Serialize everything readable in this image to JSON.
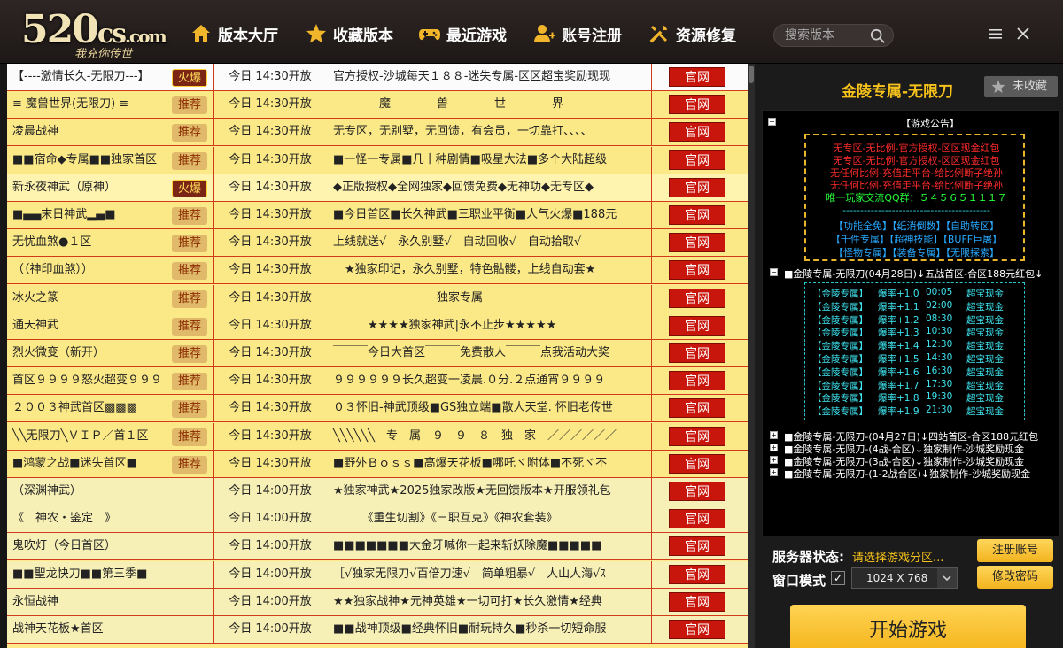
{
  "header": {
    "logo_main": "520",
    "logo_cs": "cs",
    "logo_com": ".com",
    "logo_slogan": "我充你传世",
    "nav": [
      {
        "label": "版本大厅",
        "icon": "home-icon"
      },
      {
        "label": "收藏版本",
        "icon": "star-icon"
      },
      {
        "label": "最近游戏",
        "icon": "gamepad-icon"
      },
      {
        "label": "账号注册",
        "icon": "add-user-icon"
      },
      {
        "label": "资源修复",
        "icon": "tools-icon"
      }
    ],
    "search_placeholder": "搜索版本"
  },
  "list": {
    "button_label": "官网",
    "rows": [
      {
        "name": "【----激情长久-无限刀---】",
        "badge": "火爆",
        "time": "今日 14:30开放",
        "desc": "官方授权-沙城每天１８８-迷失专属-区区超宝奖励现现",
        "style": "sel"
      },
      {
        "name": "≡  魔兽世界(无限刀)  ≡",
        "badge": "推荐",
        "time": "今日 14:30开放",
        "desc": "————魔————兽————世————界————",
        "style": "norm"
      },
      {
        "name": "凌晨战神",
        "badge": "推荐",
        "time": "今日 14:30开放",
        "desc": "无专区，无别墅，无回馈，有会员，一切靠打、、、、",
        "style": "norm"
      },
      {
        "name": "■■宿命◆专属■■独家首区",
        "badge": "推荐",
        "time": "今日 14:30开放",
        "desc": "■一怪一专属■几十种剧情■吸星大法■多个大陆超级",
        "style": "norm"
      },
      {
        "name": "新永夜神武（原神）",
        "badge": "火爆",
        "time": "今日 14:30开放",
        "desc": "◆正版授权◆全网独家◆回馈免费◆无神功◆无专区◆",
        "style": "hot"
      },
      {
        "name": "■▄▄末日神武▂▄■",
        "badge": "推荐",
        "time": "今日 14:30开放",
        "desc": "■今日首区■长久神武■三职业平衡■人气火爆■188元",
        "style": "norm"
      },
      {
        "name": "无忧血煞●１区",
        "badge": "推荐",
        "time": "今日 14:30开放",
        "desc": "上线就送√　永久别墅√　自动回收√　自动拾取√",
        "style": "norm"
      },
      {
        "name": "（（神印血煞））",
        "badge": "推荐",
        "time": "今日 14:30开放",
        "desc": "　★独家印记，永久别墅，特色骷髅，上线自动套★",
        "style": "norm"
      },
      {
        "name": "冰火之篆",
        "badge": "推荐",
        "time": "今日 14:30开放",
        "desc": "　　　　　　　　　独家专属",
        "style": "norm"
      },
      {
        "name": "通天神武",
        "badge": "推荐",
        "time": "今日 14:30开放",
        "desc": "　　　★★★★独家神武|永不止步★★★★★",
        "style": "norm"
      },
      {
        "name": "烈火微变（新开）",
        "badge": "推荐",
        "time": "今日 14:30开放",
        "desc": "￣￣￣今日大首区￣￣￣免费散人￣￣￣点我活动大奖",
        "style": "norm"
      },
      {
        "name": "首区９９９９怒火超变９９９",
        "badge": "推荐",
        "time": "今日 14:30开放",
        "desc": "９９９９９９长久超变一凌晨.０分.２点通宵９９９９",
        "style": "norm"
      },
      {
        "name": "２００３神武首区▩▩▩",
        "badge": "推荐",
        "time": "今日 14:30开放",
        "desc": "０３怀旧-神武顶级■GS独立端■散人天堂. 怀旧老传世",
        "style": "norm"
      },
      {
        "name": "╲╲无限刀╲ＶＩＰ／首１区",
        "badge": "推荐",
        "time": "今日 14:30开放",
        "desc": "╲╲╲╲╲╲　专　属　９　９　８　独　家　／／／／／／",
        "style": "norm"
      },
      {
        "name": "■鸿蒙之战■迷失首区■",
        "badge": "推荐",
        "time": "今日 14:30开放",
        "desc": "■野外Ｂｏｓｓ■高爆天花板■哪吒ヾ附体■不死ヾ不",
        "style": "norm"
      },
      {
        "name": "（深渊神武）",
        "badge": "",
        "time": "今日 14:00开放",
        "desc": "★独家神武★2025独家改版★无回馈版本★开服领礼包",
        "style": "green"
      },
      {
        "name": "《　神农・鉴定　》",
        "badge": "",
        "time": "今日 14:00开放",
        "desc": "　　　《重生切割》《三职互克》《神农套装》",
        "style": "green"
      },
      {
        "name": "鬼吹灯（今日首区）",
        "badge": "",
        "time": "今日 14:00开放",
        "desc": "■■■■■■■大金牙喊你一起来斩妖除魔■■■■■",
        "style": "green"
      },
      {
        "name": "■■聖龙快刀■■第三季■",
        "badge": "",
        "time": "今日 14:00开放",
        "desc": "［√独家无限刀√百倍刀速√　简单粗暴√　人山人海√ｽ",
        "style": "green"
      },
      {
        "name": "永恒战神",
        "badge": "",
        "time": "今日 14:00开放",
        "desc": "★★独家战神★元神英雄★一切可打★长久激情★经典",
        "style": "green"
      },
      {
        "name": "战神天花板★首区",
        "badge": "",
        "time": "今日 14:00开放",
        "desc": "■■战神顶级■经典怀旧■耐玩持久■秒杀一切短命服",
        "style": "green"
      }
    ]
  },
  "right": {
    "title": "金陵专属-无限刀",
    "fav_label": "未收藏",
    "notice": {
      "root_label": "【游戏公告】",
      "red_lines": [
        "无专区-无比例-官方授权-区区现金红包",
        "无专区-无比例-官方授权-区区现金红包",
        "无任何比例-充值走平台-给比例断子绝孙",
        "无任何比例-充值走平台-给比例断子绝孙"
      ],
      "qq_line": "唯一玩家交流QQ群：５４５６５１１１７",
      "dash_line": "------------------------------------------",
      "features_row1": "【功能全免】【纸消倒数】【自助转区】",
      "features_row2": "【千件专属】【超神技能】【BUFF巨屠】",
      "features_row3": "【怪物专属】【装备专属】【无限探索】",
      "server1_label": "■金陵专属-无限刀(04月28日)↓五战首区-合区188元红包↓",
      "rates": [
        {
          "name": "【金陵专属】",
          "rate": "爆率+1.0",
          "time": "00:05",
          "prize": "超宝现金"
        },
        {
          "name": "【金陵专属】",
          "rate": "爆率+1.1",
          "time": "02:00",
          "prize": "超宝现金"
        },
        {
          "name": "【金陵专属】",
          "rate": "爆率+1.2",
          "time": "08:30",
          "prize": "超宝现金"
        },
        {
          "name": "【金陵专属】",
          "rate": "爆率+1.3",
          "time": "10:30",
          "prize": "超宝现金"
        },
        {
          "name": "【金陵专属】",
          "rate": "爆率+1.4",
          "time": "12:30",
          "prize": "超宝现金"
        },
        {
          "name": "【金陵专属】",
          "rate": "爆率+1.5",
          "time": "14:30",
          "prize": "超宝现金"
        },
        {
          "name": "【金陵专属】",
          "rate": "爆率+1.6",
          "time": "16:30",
          "prize": "超宝现金"
        },
        {
          "name": "【金陵专属】",
          "rate": "爆率+1.7",
          "time": "17:30",
          "prize": "超宝现金"
        },
        {
          "name": "【金陵专属】",
          "rate": "爆率+1.8",
          "time": "19:30",
          "prize": "超宝现金"
        },
        {
          "name": "【金陵专属】",
          "rate": "爆率+1.9",
          "time": "21:30",
          "prize": "超宝现金"
        }
      ],
      "other_servers": [
        "■金陵专属-无限刀-(04月27日)↓四站首区-合区188元红包",
        "■金陵专属-无限刀-(4战-合区)↓独家制作-沙城奖励现金",
        "■金陵专属-无限刀-(3战-合区)↓独家制作-沙城奖励现金",
        "■金陵专属-无限刀-(1-2战合区)↓独家制作-沙城奖励现金"
      ]
    },
    "status_label": "服务器状态:",
    "status_value": "请选择游戏分区...",
    "mode_label": "窗口模式",
    "mode_checked": "✓",
    "resolution": "1024 X 768",
    "register_label": "注册账号",
    "change_pwd_label": "修改密码",
    "start_label": "开始游戏"
  }
}
